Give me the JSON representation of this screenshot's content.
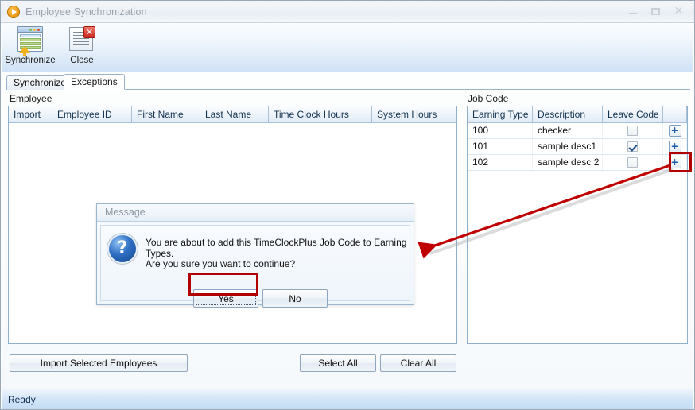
{
  "window": {
    "title": "Employee Synchronization",
    "icon": "play-circle-icon",
    "controls": {
      "minimize": "minimize-icon",
      "maximize": "maximize-icon",
      "close": "close-icon"
    }
  },
  "toolbar": {
    "items": [
      {
        "label": "Synchronize",
        "icon": "synchronize-icon"
      },
      {
        "label": "Close",
        "icon": "close-document-icon"
      }
    ]
  },
  "tabs": [
    {
      "label": "Synchronize",
      "selected": false
    },
    {
      "label": "Exceptions",
      "selected": true
    }
  ],
  "employee_panel": {
    "group_label": "Employee",
    "columns": [
      "Import",
      "Employee ID",
      "First Name",
      "Last Name",
      "Time Clock Hours",
      "System Hours"
    ],
    "rows": []
  },
  "jobcode_panel": {
    "group_label": "Job Code",
    "columns": [
      "Earning Type",
      "Description",
      "Leave Code",
      ""
    ],
    "add_button_label": "+",
    "rows": [
      {
        "earning_type": "100",
        "description": "checker",
        "leave_code": false
      },
      {
        "earning_type": "101",
        "description": "sample desc1",
        "leave_code": true
      },
      {
        "earning_type": "102",
        "description": "sample desc 2",
        "leave_code": false
      }
    ]
  },
  "footer": {
    "import_label": "Import Selected Employees",
    "select_all_label": "Select All",
    "clear_all_label": "Clear All"
  },
  "statusbar": {
    "text": "Ready"
  },
  "dialog": {
    "title": "Message",
    "icon": "question-icon",
    "line1": "You are about to add this TimeClockPlus Job Code to Earning Types.",
    "line2": "Are you sure you want to continue?",
    "yes_label": "Yes",
    "no_label": "No"
  },
  "annotations": {
    "highlight_color": "#b00000",
    "arrow_color": "#c00000",
    "targets": [
      "jobcode-add-button-row-3",
      "dialog-yes-button"
    ]
  },
  "colors": {
    "accent": "#1f5fa8",
    "title_text": "#9aa3ad",
    "panel_border": "#8fb0cd",
    "status_bg": "#c3dcf3"
  }
}
